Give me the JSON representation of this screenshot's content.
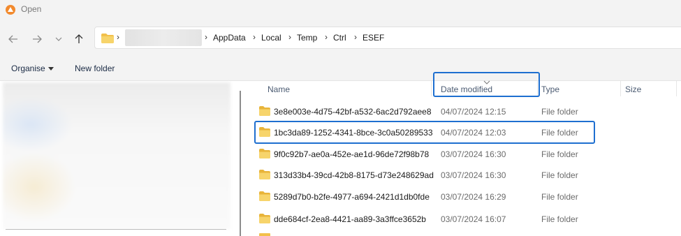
{
  "window": {
    "title": "Open"
  },
  "nav": {
    "back_icon": "arrow-left-icon",
    "forward_icon": "arrow-right-icon",
    "recent_icon": "chevron-down-icon",
    "up_icon": "arrow-up-icon"
  },
  "address": {
    "sep": "›",
    "crumbs": [
      "AppData",
      "Local",
      "Temp",
      "Ctrl",
      "ESEF"
    ]
  },
  "toolbar": {
    "organise_label": "Organise",
    "new_folder_label": "New folder"
  },
  "columns": {
    "name": "Name",
    "date_modified": "Date modified",
    "type": "Type",
    "size": "Size"
  },
  "sort": {
    "column": "Date modified",
    "direction": "descending"
  },
  "files": [
    {
      "name": "3e8e003e-4d75-42bf-a532-6ac2d792aee8",
      "date": "04/07/2024 12:15",
      "type": "File folder"
    },
    {
      "name": "1bc3da89-1252-4341-8bce-3c0a50289533",
      "date": "04/07/2024 12:03",
      "type": "File folder"
    },
    {
      "name": "9f0c92b7-ae0a-452e-ae1d-96de72f98b78",
      "date": "03/07/2024 16:30",
      "type": "File folder"
    },
    {
      "name": "313d33b4-39cd-42b8-8175-d73e248629ad",
      "date": "03/07/2024 16:30",
      "type": "File folder"
    },
    {
      "name": "5289d7b0-b2fe-4977-a694-2421d1db0fde",
      "date": "03/07/2024 16:29",
      "type": "File folder"
    },
    {
      "name": "dde684cf-2ea8-4421-aa89-3a3ffce3652b",
      "date": "03/07/2024 16:07",
      "type": "File folder"
    }
  ],
  "colors": {
    "accent": "#1e6fd0",
    "folder": "#f2c04b"
  }
}
